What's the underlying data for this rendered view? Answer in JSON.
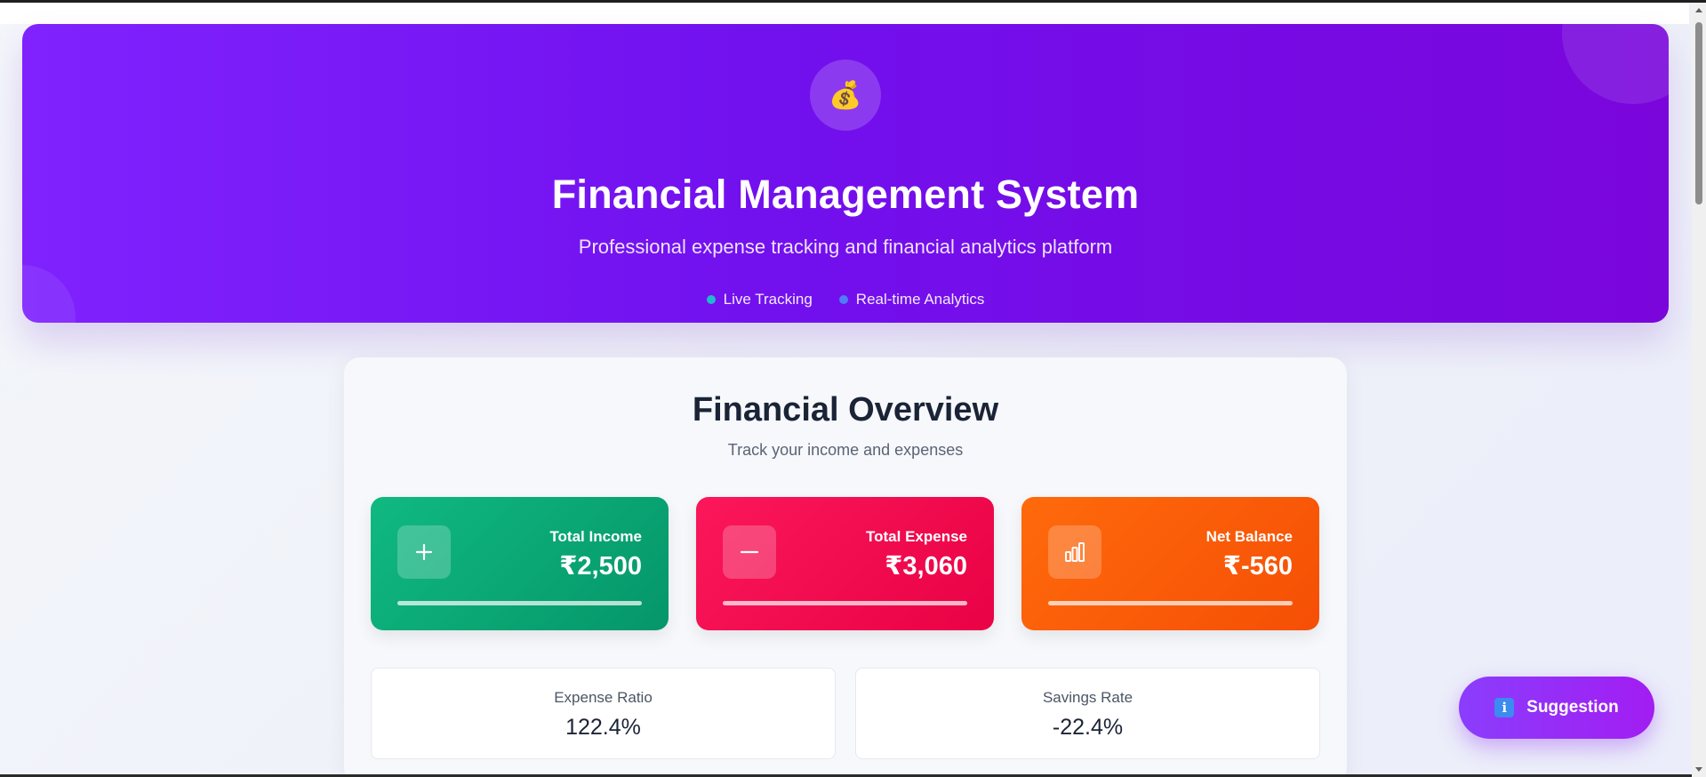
{
  "hero": {
    "icon": "money-bag-icon",
    "icon_glyph": "💰",
    "title": "Financial Management System",
    "subtitle": "Professional expense tracking and financial analytics platform",
    "tags": [
      {
        "label": "Live Tracking",
        "dot_color": "#22b8cf"
      },
      {
        "label": "Real-time Analytics",
        "dot_color": "#4f7cf7"
      }
    ]
  },
  "overview": {
    "title": "Financial Overview",
    "subtitle": "Track your income and expenses",
    "cards": [
      {
        "label": "Total Income",
        "value": "₹2,500",
        "icon": "plus-icon",
        "color": "#10b981",
        "progress": 1.0
      },
      {
        "label": "Total Expense",
        "value": "₹3,060",
        "icon": "minus-icon",
        "color": "#f4134f",
        "progress": 1.0
      },
      {
        "label": "Net Balance",
        "value": "₹-560",
        "icon": "bar-chart-icon",
        "color": "#fb5e09",
        "progress": 1.0
      }
    ],
    "stats": [
      {
        "label": "Expense Ratio",
        "value": "122.4%"
      },
      {
        "label": "Savings Rate",
        "value": "-22.4%"
      }
    ]
  },
  "suggestion_button": {
    "icon": "info-icon",
    "icon_glyph": "i",
    "label": "Suggestion"
  }
}
